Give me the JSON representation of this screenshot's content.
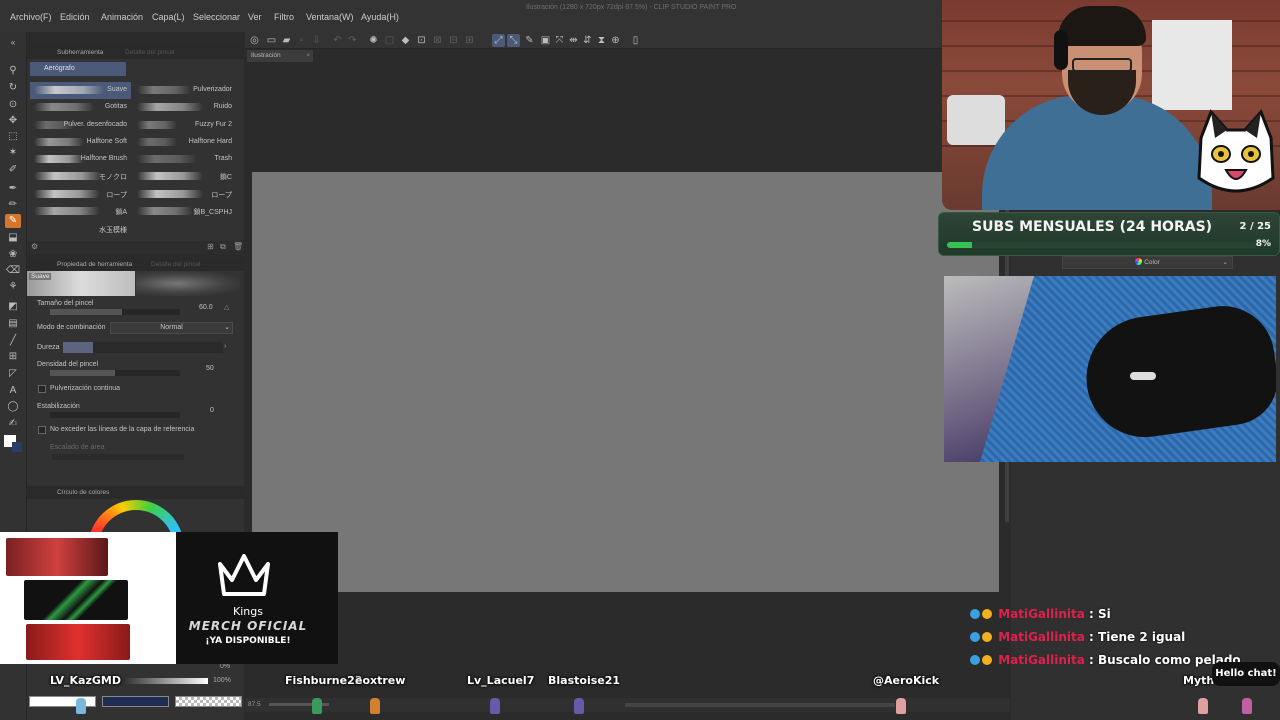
{
  "app": {
    "window_title": "Ilustración (1280 x 720px 72dpi 87.5%) - CLIP STUDIO PAINT PRO",
    "menu": [
      "Archivo(F)",
      "Edición",
      "Animación",
      "Capa(L)",
      "Seleccionar",
      "Ver",
      "Filtro",
      "Ventana(W)",
      "Ayuda(H)"
    ]
  },
  "subtool_panel": {
    "tabs": [
      "Subherramienta",
      "Detalle del pincel"
    ],
    "group": "Aerógrafo",
    "brushes_left": [
      "Suave",
      "Gotitas",
      "Pulver. desenfocado",
      "Halftone Soft",
      "Halftone Brush",
      "モノクロ",
      "ロープ",
      "鎖A",
      "水玉模様"
    ],
    "brushes_right": [
      "Pulverizador",
      "Ruido",
      "Fuzzy Fur 2",
      "Halftone Hard",
      "Trash",
      "鎖C",
      "ロープ",
      "鎖B_CSPHJ"
    ]
  },
  "tool_property": {
    "tabs": [
      "Propiedad de herramienta",
      "Detalle del pincel"
    ],
    "preview_label": "Suave",
    "brush_size_label": "Tamaño del pincel",
    "brush_size_value": "60.0",
    "blend_mode_label": "Modo de combinación",
    "blend_mode_value": "Normal",
    "hardness_label": "Dureza",
    "density_label": "Densidad del pincel",
    "density_value": "50",
    "continuous_spray_label": "Pulverización continua",
    "stabilization_label": "Estabilización",
    "stabilization_value": "0",
    "no_exceed_label": "No exceder las líneas de la capa de referencia",
    "area_scaling_label": "Escalado de área"
  },
  "color_panel": {
    "tab": "Círculo de colores",
    "percent_a": "0%",
    "percent_b": "100%",
    "dropdown": "Color"
  },
  "canvas": {
    "tab": "Ilustración",
    "zoom": "87.5",
    "paper_color": "#777777"
  },
  "stream": {
    "subs_title": "SUBS MENSUALES (24 HORAS)",
    "subs_count": "2 / 25",
    "subs_percent": "8%",
    "subs_progress": 0.08,
    "chat": [
      {
        "user": "MatiGallinita",
        "text": "Si"
      },
      {
        "user": "MatiGallinita",
        "text": "Tiene 2 igual"
      },
      {
        "user": "MatiGallinita",
        "text": "Buscalo como pelado"
      }
    ],
    "speech_bubble": "Hello chat!",
    "viewers": [
      "LV_KazGMD",
      "Fishburne23",
      "eoxtrew",
      "Lv_Lacuel7",
      "Blastoise21",
      "@AeroKick",
      "Myth"
    ],
    "merch_brand": "Kings",
    "merch_title": "MERCH OFICIAL",
    "merch_subtitle": "¡YA DISPONIBLE!"
  },
  "colors": {
    "accent": "#4a5a78",
    "active_tool": "#d4772a",
    "subs_green": "#36c056",
    "chat_user": "#e0204a"
  }
}
